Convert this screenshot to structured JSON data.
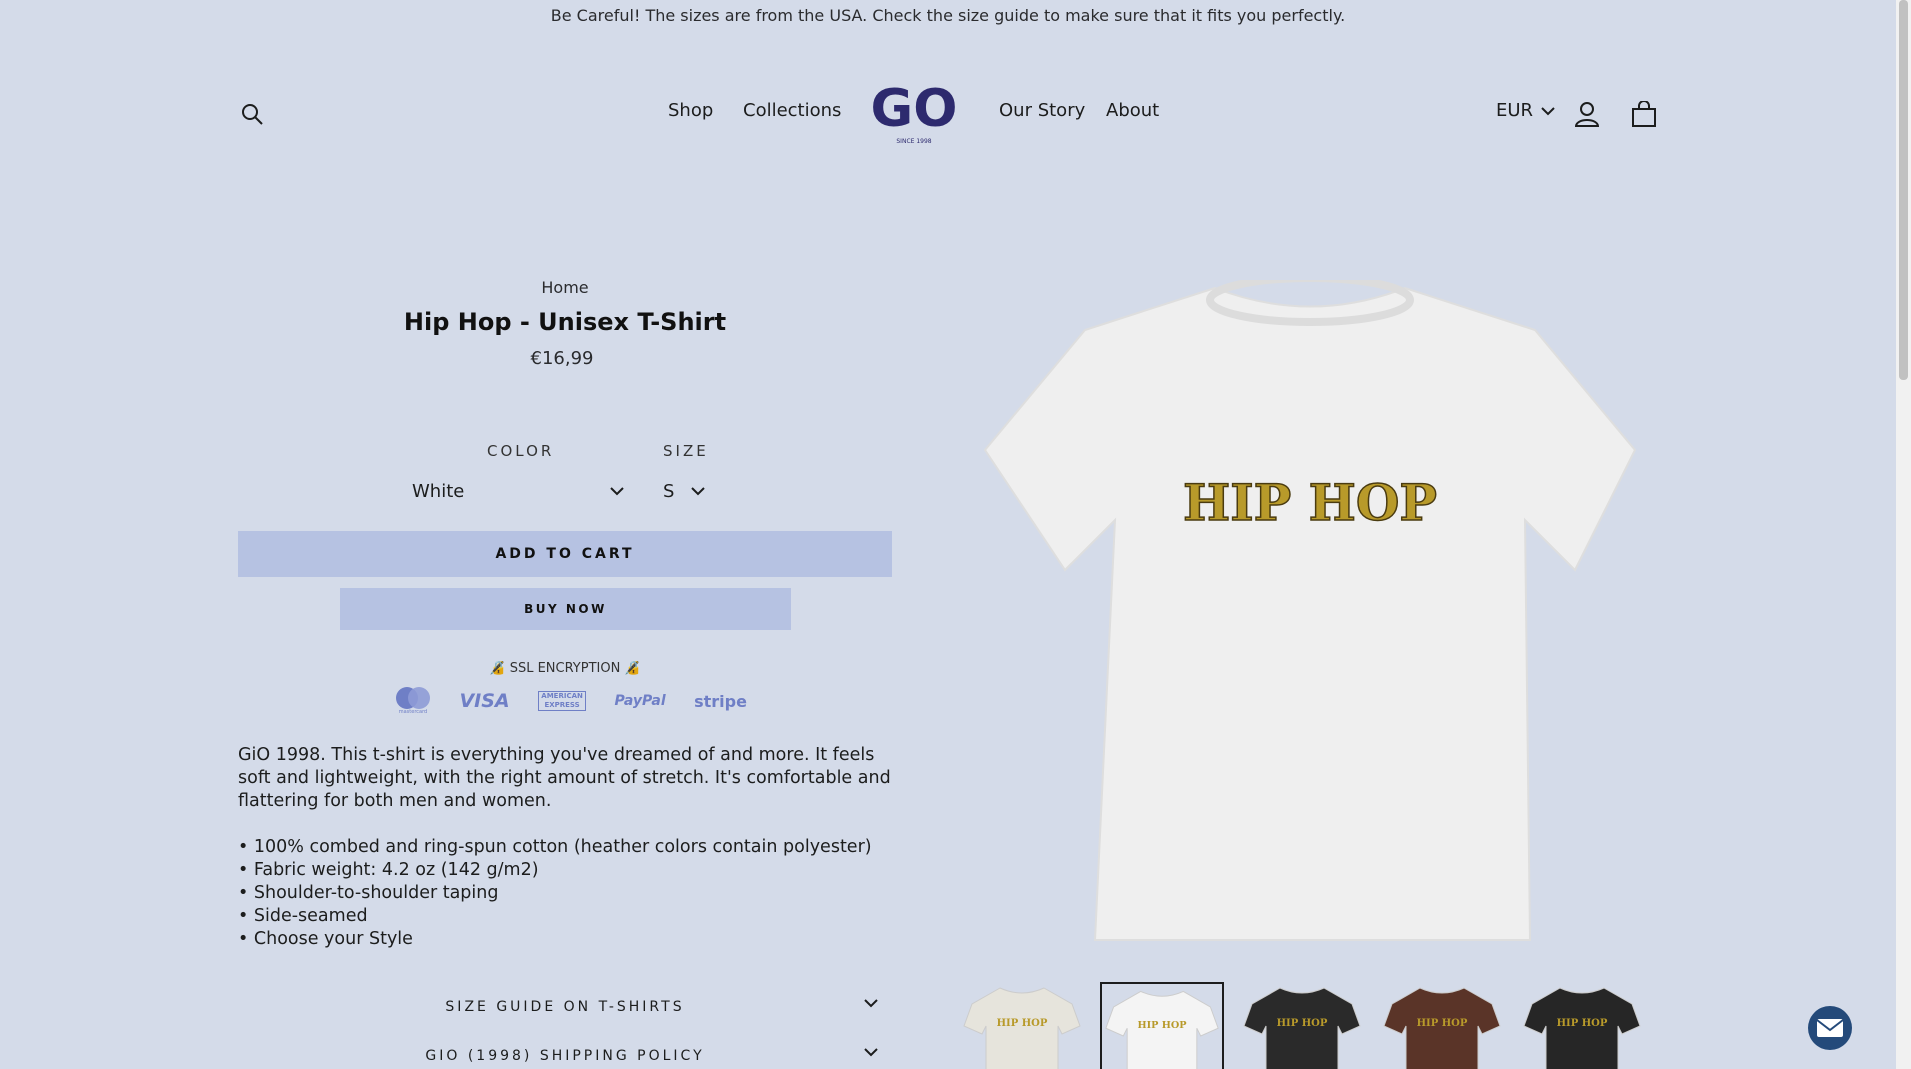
{
  "announcement": "Be Careful! The sizes are from the USA. Check the size guide to make sure that it fits you perfectly.",
  "header": {
    "nav": [
      "Shop",
      "Collections",
      "Our Story",
      "About"
    ],
    "logo_text": "GO",
    "logo_subtext": "SINCE 1998",
    "currency": "EUR",
    "icons": [
      "search-icon",
      "account-icon",
      "cart-icon"
    ]
  },
  "product": {
    "breadcrumb": "Home",
    "title": "Hip Hop - Unisex T-Shirt",
    "price": "€16,99",
    "print_text": "HIP HOP",
    "options": {
      "color_label": "COLOR",
      "color_value": "White",
      "size_label": "SIZE",
      "size_value": "S"
    },
    "add_to_cart": "ADD TO CART",
    "buy_now": "BUY NOW",
    "ssl_text": "🔏 SSL ENCRYPTION 🔏",
    "payments": [
      "mastercard",
      "VISA",
      "AMERICAN EXPRESS",
      "PayPal",
      "stripe"
    ],
    "description": "GiO 1998. This t-shirt is everything you've dreamed of and more. It feels soft and lightweight, with the right amount of stretch. It's comfortable and flattering for both men and women.",
    "bullets": [
      "• 100% combed and ring-spun cotton (heather colors contain polyester)",
      "• Fabric weight: 4.2 oz (142 g/m2)",
      "• Shoulder-to-shoulder taping",
      "• Side-seamed",
      "• Choose your Style"
    ],
    "accordions": [
      "SIZE GUIDE ON T-SHIRTS",
      "GIO (1998) SHIPPING POLICY"
    ]
  },
  "thumbnails": [
    {
      "color": "#e6e4dc",
      "active": false
    },
    {
      "color": "#f4f4f4",
      "active": true
    },
    {
      "color": "#2a2a2a",
      "active": false
    },
    {
      "color": "#5a3428",
      "active": false
    },
    {
      "color": "#262626",
      "active": false
    }
  ],
  "colors": {
    "background": "#d4dbe9",
    "button": "#b6c2e2",
    "logo": "#2d2a6e",
    "chat": "#244a7a"
  }
}
